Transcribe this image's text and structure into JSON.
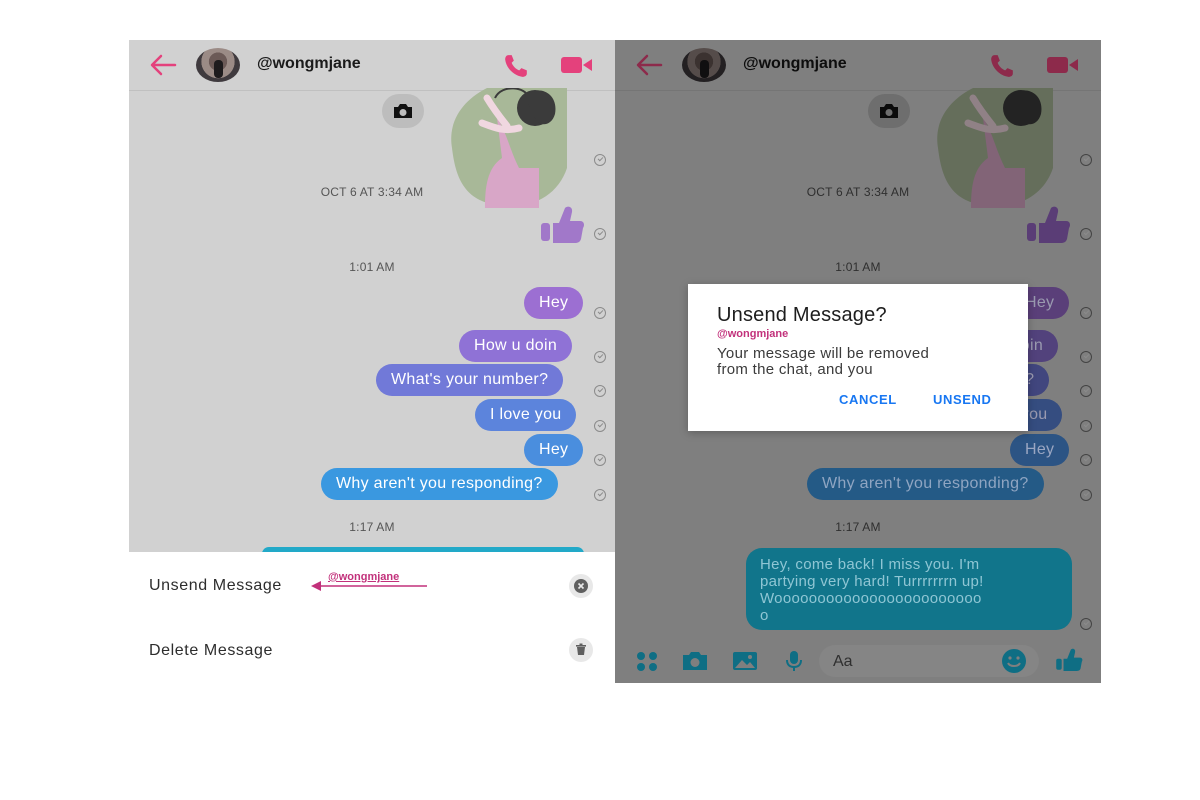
{
  "chat_title": "@wongmjane",
  "timestamps": [
    "OCT 6 AT 3:34 AM",
    "1:01 AM",
    "1:17 AM"
  ],
  "messages": {
    "hey1": "Hey",
    "how": "How u doin",
    "number": "What's your number?",
    "love": "I love you",
    "hey2": "Hey",
    "why": "Why aren't you responding?"
  },
  "long_message": {
    "line1": "Hey, come back! I miss you. I'm",
    "line2": "partying very hard! Turrrrrrrn up!",
    "line3": "Woooooooooooooooooooooooo",
    "line4": "o"
  },
  "sheet": {
    "unsend": "Unsend Message",
    "delete": "Delete Message",
    "annotation": "@wongmjane"
  },
  "dialog": {
    "title": "Unsend Message?",
    "user": "@wongmjane",
    "body_line1": "Your message will be removed",
    "body_line2": "from the chat, and you",
    "cancel": "CANCEL",
    "unsend": "UNSEND"
  },
  "composer": {
    "placeholder": "Aa"
  },
  "colors": {
    "accent_pink": "#e4417c",
    "bubble_purple": "#9c6fd2",
    "bubble_blue": "#3a8fe0",
    "bubble_teal": "#19a9c9",
    "dialog_button": "#1877f2",
    "annotation": "#c2317b"
  },
  "icons": [
    "back-arrow-icon",
    "phone-icon",
    "video-icon",
    "camera-icon",
    "thumbs-up-icon",
    "seen-check-icon",
    "close-circle-icon",
    "trash-icon",
    "apps-icon",
    "image-icon",
    "microphone-icon",
    "emoji-icon"
  ]
}
